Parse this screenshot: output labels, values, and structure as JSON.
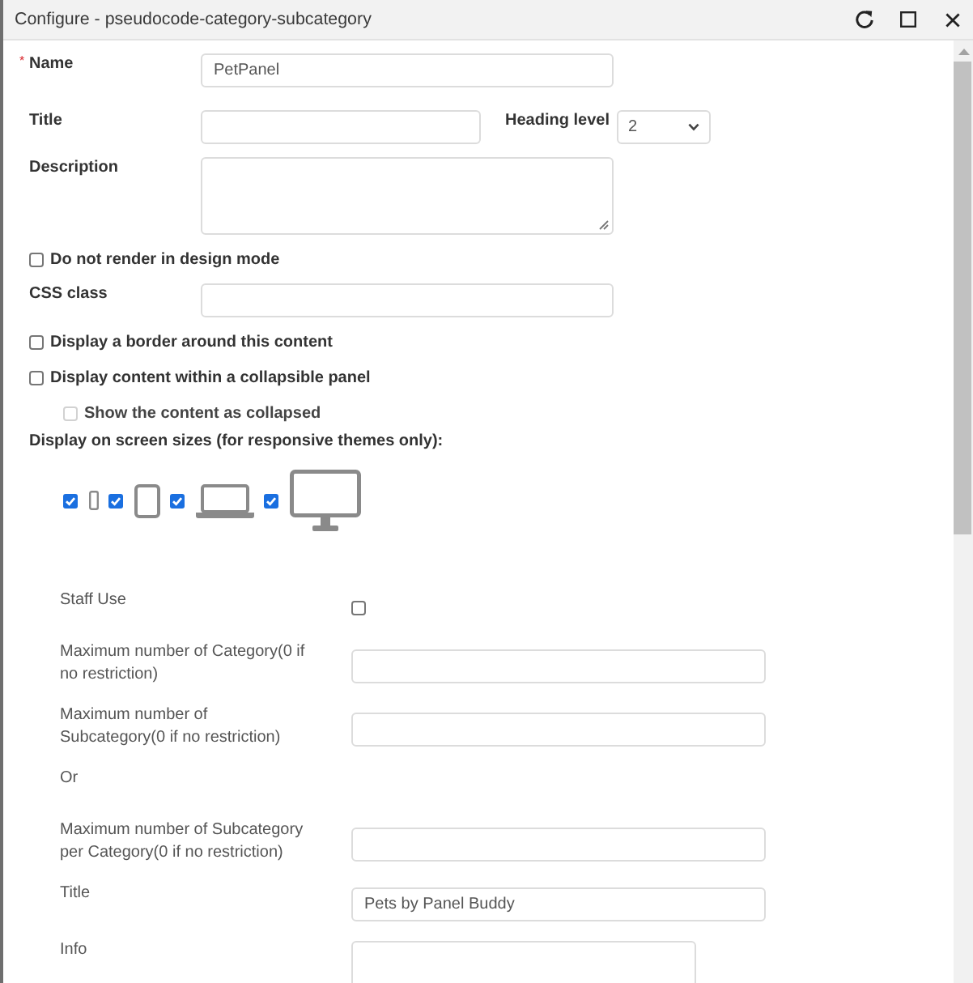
{
  "window": {
    "title": "Configure - pseudocode-category-subcategory"
  },
  "general": [
    {
      "kind": "text",
      "label": "Name",
      "required_mark": "*",
      "value": "PetPanel"
    },
    {
      "kind": "text",
      "label": "Title",
      "select": {
        "label": "Heading level",
        "value": "2"
      }
    },
    {
      "kind": "textarea",
      "label": "Description"
    },
    {
      "kind": "checkbox",
      "label": "Do not render in design mode",
      "checked": false,
      "disabled": false
    },
    {
      "kind": "text",
      "label": "CSS class"
    },
    {
      "kind": "checkbox",
      "label": "Display a border around this content",
      "checked": false,
      "disabled": false
    },
    {
      "kind": "checkbox",
      "label": "Display content within a collapsible panel",
      "checked": false,
      "disabled": false,
      "children": [
        {
          "kind": "checkbox",
          "label": "Show the content as collapsed",
          "checked": false,
          "disabled": true
        }
      ]
    },
    {
      "kind": "devices",
      "label": "Display on screen sizes (for responsive themes only):",
      "devices": [
        {
          "kind": "phone",
          "checked": true
        },
        {
          "kind": "tablet",
          "checked": true
        },
        {
          "kind": "laptop",
          "checked": true
        },
        {
          "kind": "desktop",
          "checked": true
        }
      ]
    }
  ],
  "settings": [
    {
      "kind": "checkbox",
      "label": "Staff Use",
      "checked": false
    },
    {
      "kind": "text",
      "label": "Maximum number of Category(0 if no restriction)"
    },
    {
      "kind": "text",
      "label": "Maximum number of Subcategory(0 if no restriction)"
    },
    {
      "kind": "note",
      "label": "Or"
    },
    {
      "kind": "text",
      "label": "Maximum number of Subcategory per Category(0 if no restriction)"
    },
    {
      "kind": "text",
      "label": "Title",
      "value": "Pets by Panel Buddy"
    },
    {
      "kind": "textarea",
      "label": "Info"
    }
  ]
}
